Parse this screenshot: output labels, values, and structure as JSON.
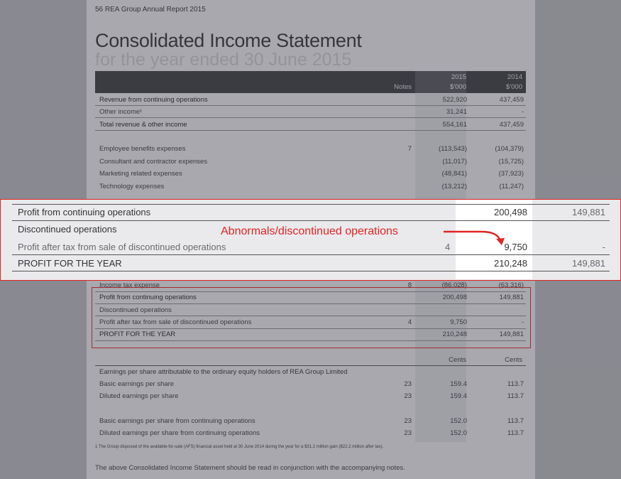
{
  "header": {
    "page_label": "56  REA Group Annual Report 2015"
  },
  "title": "Consolidated Income Statement",
  "subtitle": "for the year ended 30 June 2015",
  "columns": {
    "notes": "Notes",
    "y2015": "2015",
    "y2014": "2014",
    "unit2015": "$'000",
    "unit2014": "$'000"
  },
  "rows_top": [
    {
      "label": "Revenue from continuing operations",
      "notes": "",
      "v2015": "522,920",
      "v2014": "437,459"
    },
    {
      "label": "Other income¹",
      "notes": "",
      "v2015": "31,241",
      "v2014": "-"
    },
    {
      "label": "Total revenue & other income",
      "notes": "",
      "v2015": "554,161",
      "v2014": "437,459"
    },
    {
      "label": "Employee benefits expenses",
      "notes": "7",
      "v2015": "(113,543)",
      "v2014": "(104,379)"
    },
    {
      "label": "Consultant and contractor expenses",
      "notes": "",
      "v2015": "(11,017)",
      "v2014": "(15,725)"
    },
    {
      "label": "Marketing related expenses",
      "notes": "",
      "v2015": "(48,841)",
      "v2014": "(37,923)"
    },
    {
      "label": "Technology expenses",
      "notes": "",
      "v2015": "(13,212)",
      "v2014": "(11,247)"
    }
  ],
  "zoom": {
    "rows": [
      {
        "label": "Profit from continuing operations",
        "notes": "",
        "v2015": "200,498",
        "v2014": "149,881"
      },
      {
        "label": "Discontinued operations",
        "notes": "",
        "v2015": "",
        "v2014": ""
      },
      {
        "label": "Profit after tax from sale of discontinued operations",
        "notes": "4",
        "v2015": "9,750",
        "v2014": "-"
      },
      {
        "label": "PROFIT FOR THE YEAR",
        "notes": "",
        "v2015": "210,248",
        "v2014": "149,881"
      }
    ],
    "annotation": "Abnormals/discontinued operations"
  },
  "rows_mid": [
    {
      "label": "Income tax expense",
      "notes": "8",
      "v2015": "(86,028)",
      "v2014": "(63,316)"
    },
    {
      "label": "Profit from continuing operations",
      "notes": "",
      "v2015": "200,498",
      "v2014": "149,881"
    },
    {
      "label": "Discontinued operations",
      "notes": "",
      "v2015": "",
      "v2014": ""
    },
    {
      "label": "Profit after tax from sale of discontinued operations",
      "notes": "4",
      "v2015": "9,750",
      "v2014": "-"
    },
    {
      "label": "PROFIT FOR THE YEAR",
      "notes": "",
      "v2015": "210,248",
      "v2014": "149,881"
    }
  ],
  "cents": {
    "c2015": "Cents",
    "c2014": "Cents"
  },
  "eps_heading": "Earnings per share attributable to the ordinary equity holders of REA Group Limited",
  "rows_eps": [
    {
      "label": "Basic earnings per share",
      "notes": "23",
      "v2015": "159.4",
      "v2014": "113.7"
    },
    {
      "label": "Diluted earnings per share",
      "notes": "23",
      "v2015": "159.4",
      "v2014": "113.7"
    },
    {
      "label": "Basic earnings per share from continuing operations",
      "notes": "23",
      "v2015": "152.0",
      "v2014": "113.7"
    },
    {
      "label": "Diluted earnings per share from continuing operations",
      "notes": "23",
      "v2015": "152.0",
      "v2014": "113.7"
    }
  ],
  "footnote": "1  The Group disposed of the available-for-sale (AFS) financial asset held at 30 June 2014 during the year for a $31.2 million gain ($22.2 million after tax).",
  "closing_note": "The above Consolidated Income Statement should be read in conjunction with the accompanying notes."
}
